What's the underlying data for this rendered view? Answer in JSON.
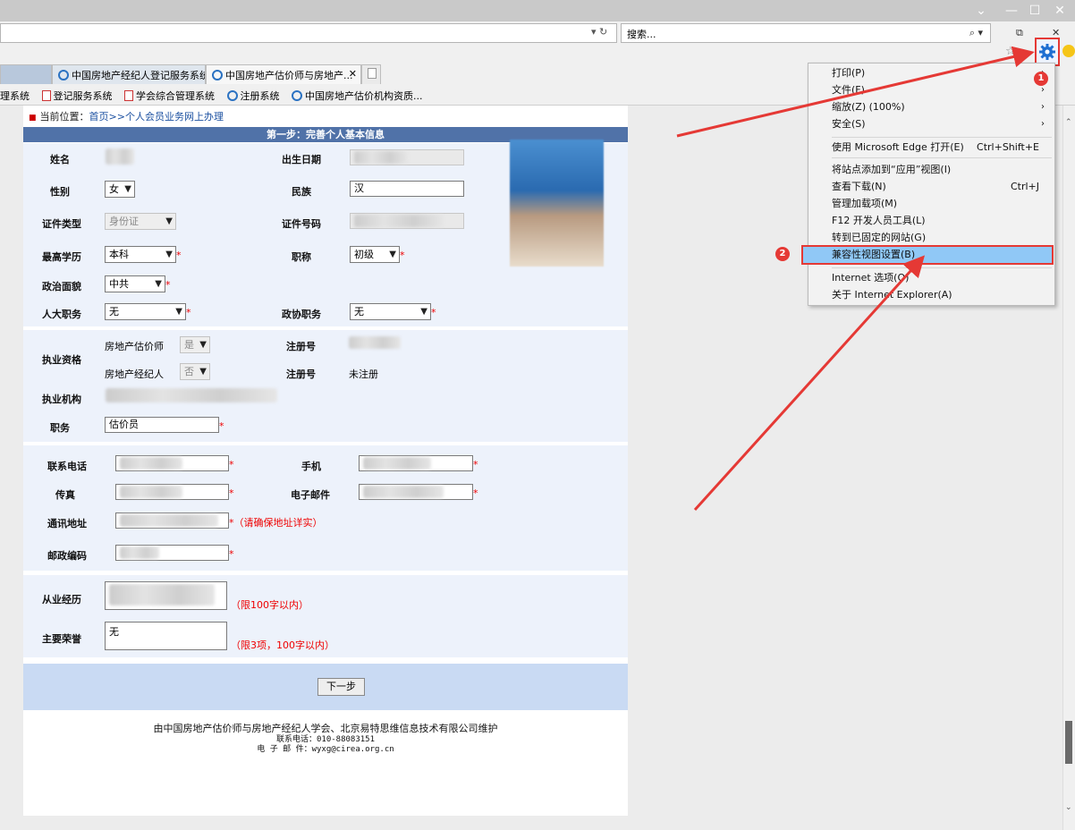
{
  "window": {
    "minimize": "⌄",
    "min2": "—",
    "maximize": "☐",
    "close": "✕",
    "restore": "⧉"
  },
  "address": {
    "refresh_icon": "refresh-icon",
    "dropdown": "▾ ↻"
  },
  "search": {
    "placeholder": "搜索...",
    "icons": "⌕ ▾"
  },
  "tabs": [
    {
      "label": "中国房地产经纪人登记服务系统"
    },
    {
      "label": "中国房地产估价师与房地产..."
    }
  ],
  "tab_close": "✕",
  "favorites": [
    "理系统",
    "登记服务系统",
    "学会综合管理系统",
    "注册系统",
    "中国房地产估价机构资质..."
  ],
  "breadcrumb": {
    "prefix": "当前位置：",
    "home": "首页",
    "sep": ">>",
    "current": "个人会员业务网上办理"
  },
  "step_title": "第一步：完善个人基本信息",
  "form": {
    "name_label": "姓名",
    "birth_label": "出生日期",
    "gender_label": "性别",
    "gender_value": "女",
    "ethnic_label": "民族",
    "ethnic_value": "汉",
    "idtype_label": "证件类型",
    "idtype_value": "身份证",
    "idno_label": "证件号码",
    "edu_label": "最高学历",
    "edu_value": "本科",
    "title_label": "职称",
    "title_value": "初级",
    "politic_label": "政治面貌",
    "politic_value": "中共",
    "npc_label": "人大职务",
    "npc_value": "无",
    "cppcc_label": "政协职务",
    "cppcc_value": "无",
    "qual_label": "执业资格",
    "appraiser_label": "房地产估价师",
    "appraiser_value": "是",
    "reg_label": "注册号",
    "broker_label": "房地产经纪人",
    "broker_value": "否",
    "reg2_label": "注册号",
    "reg2_value": "未注册",
    "org_label": "执业机构",
    "post_label": "职务",
    "post_value": "估价员",
    "phone_label": "联系电话",
    "mobile_label": "手机",
    "fax_label": "传真",
    "email_label": "电子邮件",
    "addr_label": "通讯地址",
    "addr_hint": "（请确保地址详实）",
    "zip_label": "邮政编码",
    "career_label": "从业经历",
    "career_hint": "（限100字以内）",
    "honor_label": "主要荣誉",
    "honor_value": "无",
    "honor_hint": "（限3项，100字以内）",
    "star": "*"
  },
  "next_button": "下一步",
  "footer": {
    "line1": "由中国房地产估价师与房地产经纪人学会、北京易特思维信息技术有限公司维护",
    "line2": "联系电话：010-88083151",
    "line3": "电 子 邮 件：wyxg@cirea.org.cn"
  },
  "menu": {
    "items": [
      {
        "label": "打印(P)",
        "shortcut": "",
        "sub": "›"
      },
      {
        "label": "文件(F)",
        "shortcut": "",
        "sub": "›"
      },
      {
        "label": "缩放(Z) (100%)",
        "shortcut": "",
        "sub": "›"
      },
      {
        "label": "安全(S)",
        "shortcut": "",
        "sub": "›"
      },
      {
        "label": "使用 Microsoft Edge 打开(E)",
        "shortcut": "Ctrl+Shift+E",
        "sub": ""
      },
      {
        "label": "将站点添加到“应用”视图(I)",
        "shortcut": "",
        "sub": ""
      },
      {
        "label": "查看下载(N)",
        "shortcut": "Ctrl+J",
        "sub": ""
      },
      {
        "label": "管理加载项(M)",
        "shortcut": "",
        "sub": ""
      },
      {
        "label": "F12 开发人员工具(L)",
        "shortcut": "",
        "sub": ""
      },
      {
        "label": "转到已固定的网站(G)",
        "shortcut": "",
        "sub": ""
      },
      {
        "label": "兼容性视图设置(B)",
        "shortcut": "",
        "sub": ""
      },
      {
        "label": "Internet 选项(O)",
        "shortcut": "",
        "sub": ""
      },
      {
        "label": "关于 Internet Explorer(A)",
        "shortcut": "",
        "sub": ""
      }
    ]
  },
  "annotations": {
    "badge1": "1",
    "badge2": "2",
    "color": "#e53935"
  }
}
